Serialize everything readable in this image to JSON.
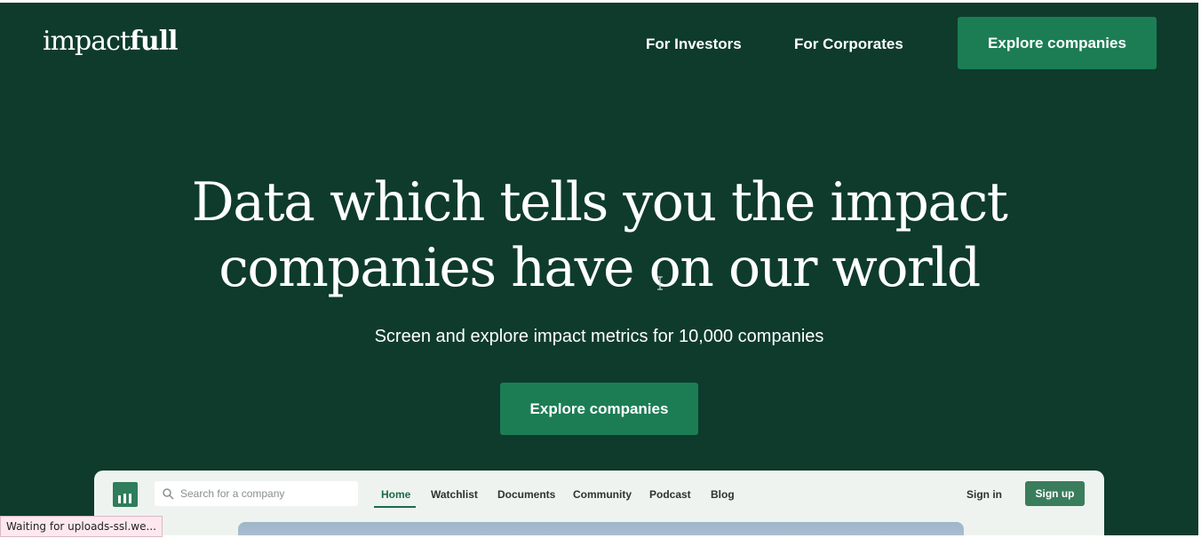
{
  "brand": {
    "logo_light": "impact",
    "logo_bold": "full"
  },
  "nav": {
    "investors": "For Investors",
    "corporates": "For Corporates",
    "cta": "Explore companies"
  },
  "hero": {
    "headline_line1": "Data which tells you the impact",
    "headline_line2": "companies have on our world",
    "subhead": "Screen and explore impact metrics for 10,000 companies",
    "cta": "Explore companies"
  },
  "preview": {
    "search_placeholder": "Search for a company",
    "tabs": [
      "Home",
      "Watchlist",
      "Documents",
      "Community",
      "Podcast",
      "Blog"
    ],
    "sign_in": "Sign in",
    "sign_up": "Sign up"
  },
  "status_bar": {
    "text": "Waiting for uploads-ssl.we..."
  },
  "colors": {
    "hero_background": "#0e3b2c",
    "accent_green": "#1c7d55",
    "text_light": "#ffffff"
  },
  "icons": [
    "search-icon",
    "impactfull-app-icon",
    "text-cursor-icon"
  ]
}
